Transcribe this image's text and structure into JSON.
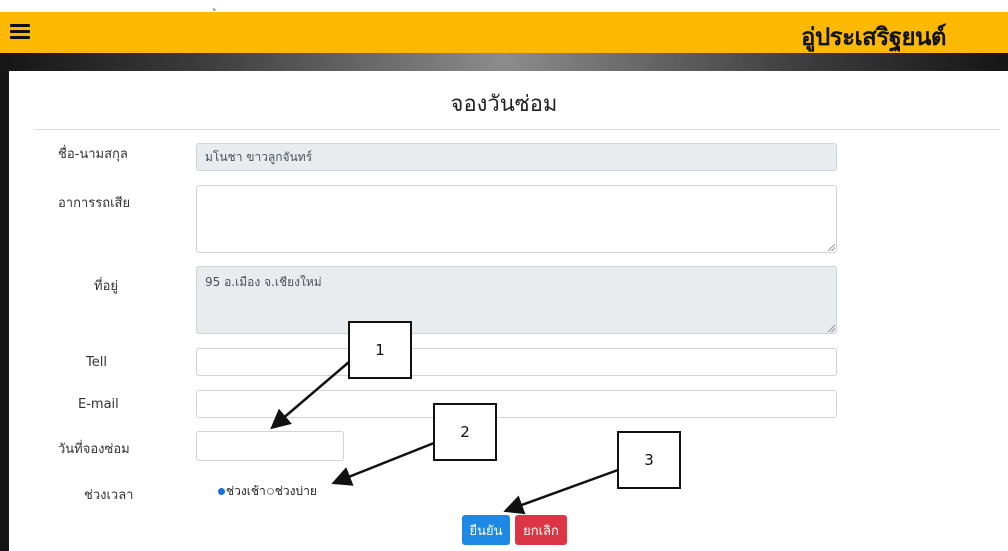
{
  "navbar": {
    "menu_icon": "hamburger-icon",
    "brand": "อู่ประเสริฐยนต์",
    "color": "#fbb901"
  },
  "page": {
    "title": "จองวันซ่อม"
  },
  "form": {
    "name_label": "ชื่อ-นามสกุล",
    "name_value": "มโนชา ขาวลูกจันทร์",
    "symptom_label": "อาการรถเสีย",
    "symptom_value": "",
    "address_label": "ที่อยู่",
    "address_value": "95 อ.เมือง จ.เชียงใหม่",
    "tel_label": "Tell",
    "tel_value": "",
    "email_label": "E-mail",
    "email_value": "",
    "date_label": "วันที่จองซ่อม",
    "date_value": "",
    "time_label": "ช่วงเวลา",
    "time_options": [
      {
        "label": "ช่วงเช้า",
        "selected": true
      },
      {
        "label": "ช่วงบ่าย",
        "selected": false
      }
    ]
  },
  "buttons": {
    "confirm_label": "ยืนยัน",
    "confirm_color": "#1e88e5",
    "cancel_label": "ยกเลิก",
    "cancel_color": "#dc3545"
  },
  "callouts": [
    "1",
    "2",
    "3"
  ]
}
